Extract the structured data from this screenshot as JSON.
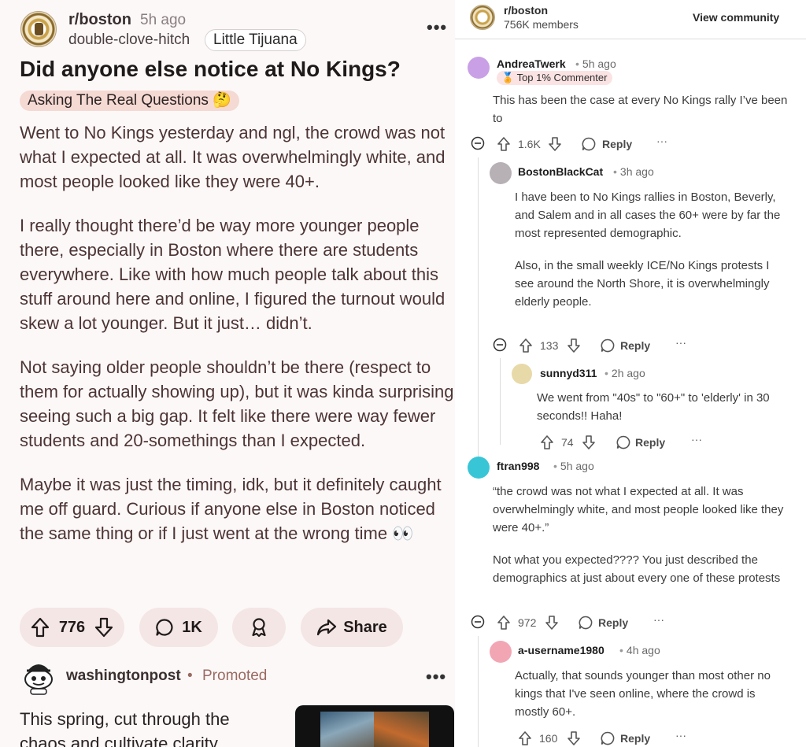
{
  "post": {
    "subreddit": "r/boston",
    "age": "5h ago",
    "author": "double-clove-hitch",
    "user_flair": "Little Tijuana",
    "title": "Did anyone else notice at No Kings?",
    "post_flair": "Asking The Real Questions 🤔",
    "paragraphs": [
      "Went to No Kings yesterday and ngl, the crowd was not what I expected at all. It was overwhelmingly white, and most people looked like they were 40+.",
      "I really thought there’d be way more younger people there, especially in Boston where there are students everywhere. Like with how much people talk about this stuff around here and online, I figured the turnout would skew a lot younger. But it just… didn’t.",
      "Not saying older people shouldn’t be there (respect to them for actually showing up), but it was kinda surprising seeing such a big gap. It felt like there were way fewer students and 20-somethings than I expected.",
      "Maybe it was just the timing, idk, but it definitely caught me off guard. Curious if anyone else in Boston noticed the same thing or if I just went at the wrong time 👀"
    ],
    "votes": "776",
    "comments": "1K",
    "share_label": "Share",
    "more_icon": "more-options-icon"
  },
  "promo": {
    "advertiser": "washingtonpost",
    "separator": "•",
    "tag": "Promoted",
    "text": "This spring, cut through the chaos and cultivate clarity"
  },
  "community": {
    "name": "r/boston",
    "members": "756K members",
    "view_label": "View community"
  },
  "comments": [
    {
      "user": "AndreaTwerk",
      "age": "5h ago",
      "badge": "Top 1% Commenter",
      "lines": [
        "This has been the case at every No Kings rally I’ve been to"
      ],
      "votes": "1.6K",
      "reply": "Reply",
      "avatar_color": "#c9a0e6"
    },
    {
      "user": "BostonBlackCat",
      "age": "3h ago",
      "paragraphs": [
        "I have been to No Kings rallies in Boston, Beverly, and Salem and in all cases the 60+ were by far the most represented demographic.",
        "Also, in the small weekly ICE/No Kings protests I see around the North Shore, it is overwhelmingly elderly people."
      ],
      "votes": "133",
      "reply": "Reply",
      "avatar_color": "#b7b0b5"
    },
    {
      "user": "sunnyd311",
      "age": "2h ago",
      "paragraphs": [
        "We went from \"40s\" to \"60+\" to 'elderly' in 30 seconds!! Haha!"
      ],
      "votes": "74",
      "reply": "Reply",
      "avatar_color": "#e8d9a8"
    },
    {
      "user": "ftran998",
      "age": "5h ago",
      "paragraphs": [
        "“the crowd was not what I expected at all. It was overwhelmingly white, and most people looked like they were 40+.”",
        "Not what you expected???? You just described the demographics at just about every one of these protests"
      ],
      "votes": "972",
      "reply": "Reply",
      "avatar_color": "#38c6d6"
    },
    {
      "user": "a-username1980",
      "age": "4h ago",
      "paragraphs": [
        "Actually, that sounds younger than most other no kings that I've seen online, where the crowd is mostly 60+."
      ],
      "votes": "160",
      "reply": "Reply",
      "avatar_color": "#f2a6b4"
    }
  ],
  "colors": {
    "accent": "#f4e6e5",
    "flair": "#f5d9d3",
    "body_text": "#4d3434",
    "promoted": "#9a6a60"
  }
}
